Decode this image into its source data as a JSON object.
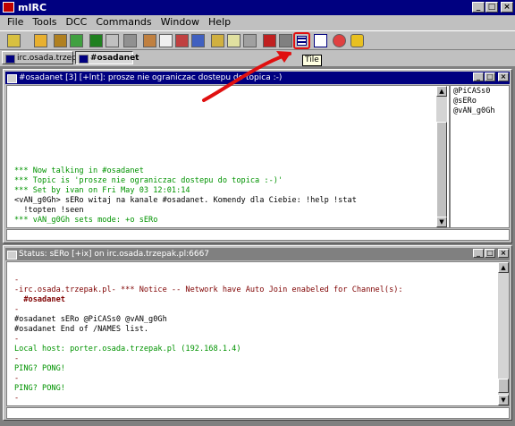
{
  "app": {
    "title": "mIRC"
  },
  "menu": [
    "File",
    "Tools",
    "DCC",
    "Commands",
    "Window",
    "Help"
  ],
  "toolbar": {
    "tooltip": "Tile"
  },
  "switchbar": {
    "tabs": [
      "irc.osada.trzep...",
      "#osadanet"
    ]
  },
  "channel_window": {
    "title": "#osadanet [3] [+lnt]: prosze nie ograniczac dostepu do topica :-)",
    "lines": [
      {
        "text": "*** Now talking in #osadanet",
        "color": "green"
      },
      {
        "text": "*** Topic is 'prosze nie ograniczac dostepu do topica :-)'",
        "color": "green"
      },
      {
        "text": "*** Set by ivan on Fri May 03 12:01:14",
        "color": "green"
      },
      {
        "text": "<vAN_g0Gh> sERo witaj na kanale #osadanet. Komendy dla Ciebie: !help !stat",
        "color": "black"
      },
      {
        "text": "  !topten !seen",
        "color": "black"
      },
      {
        "text": "*** vAN_g0Gh sets mode: +o sERo",
        "color": "green"
      }
    ],
    "nicks": [
      "@PiCASs0",
      "@sERo",
      "@vAN_g0Gh"
    ]
  },
  "status_window": {
    "title": "Status: sERo [+ix] on irc.osada.trzepak.pl:6667",
    "lines": [
      {
        "text": "-",
        "color": "red"
      },
      {
        "text": "-irc.osada.trzepak.pl- *** Notice -- Network have Auto Join enabeled for Channel(s):",
        "color": "red"
      },
      {
        "text": "  #osadanet",
        "color": "red",
        "bold": true
      },
      {
        "text": "-",
        "color": "red"
      },
      {
        "text": "#osadanet sERo @PiCASs0 @vAN_g0Gh",
        "color": "black"
      },
      {
        "text": "#osadanet End of /NAMES list.",
        "color": "black"
      },
      {
        "text": "-",
        "color": "red"
      },
      {
        "text": "Local host: porter.osada.trzepak.pl (192.168.1.4)",
        "color": "green"
      },
      {
        "text": "-",
        "color": "red"
      },
      {
        "text": "PING? PONG!",
        "color": "green"
      },
      {
        "text": "-",
        "color": "red"
      },
      {
        "text": "PING? PONG!",
        "color": "green"
      },
      {
        "text": "-",
        "color": "red"
      }
    ]
  },
  "colors": {
    "titlebar": "#000080",
    "annotation_arrow": "#e01010",
    "green_text": "#009300",
    "red_text": "#7f0000"
  }
}
